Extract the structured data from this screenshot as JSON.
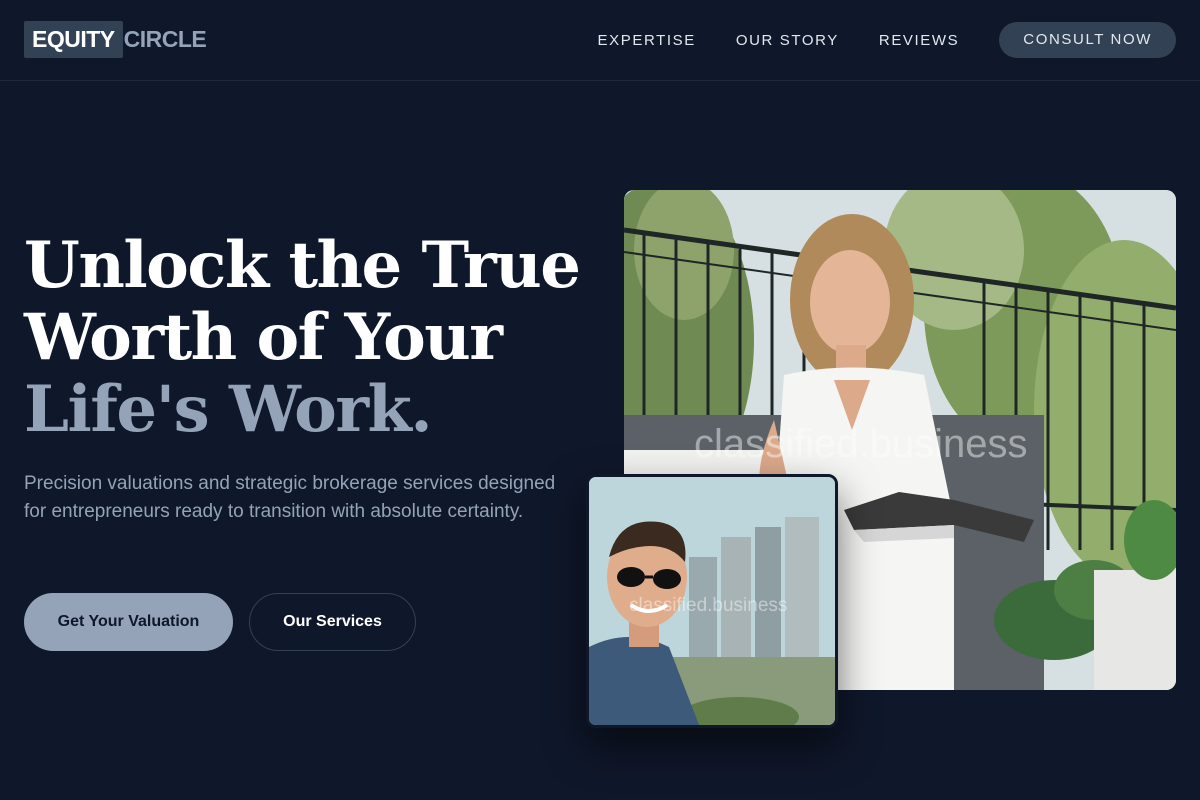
{
  "header": {
    "logo_box": "EQUITY",
    "logo_rest": "CIRCLE",
    "nav": [
      "EXPERTISE",
      "OUR STORY",
      "REVIEWS"
    ],
    "cta": "CONSULT NOW"
  },
  "hero": {
    "headline_line1": "Unlock the True",
    "headline_line2": "Worth of Your",
    "headline_line3": "Life's Work.",
    "subtext": "Precision valuations and strategic brokerage services designed for entrepreneurs ready to transition with absolute certainty.",
    "primary_button": "Get Your Valuation",
    "secondary_button": "Our Services"
  },
  "images": {
    "main_watermark": "classified.business",
    "small_watermark": "classified.business"
  },
  "colors": {
    "background": "#0f172a",
    "accent": "#94a3b8",
    "button_dark": "#334155"
  }
}
